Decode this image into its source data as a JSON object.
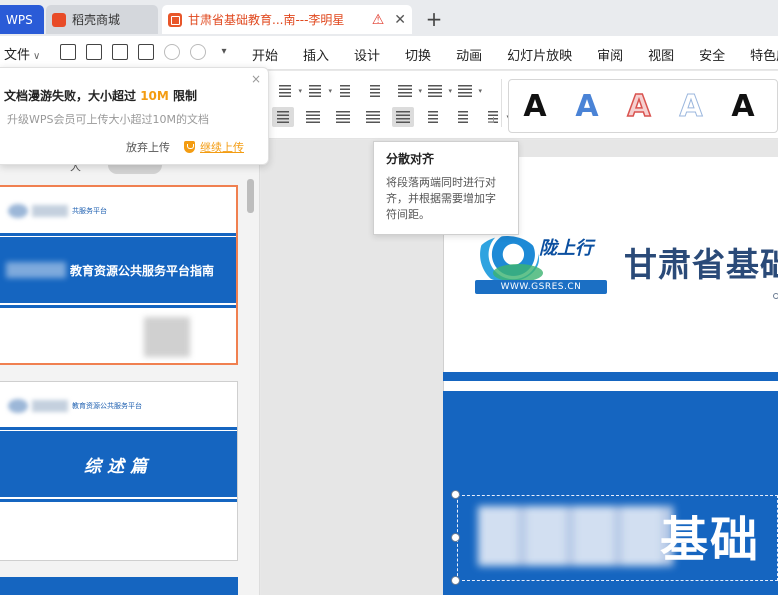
{
  "tabs": {
    "wps_label": "WPS",
    "daoke_label": "稻壳商城",
    "active_label": "甘肃省基础教育...南---李明星",
    "new_tab_label": "+"
  },
  "menu": {
    "file_label": "文件",
    "items": [
      "开始",
      "插入",
      "设计",
      "切换",
      "动画",
      "幻灯片放映",
      "审阅",
      "视图",
      "安全",
      "特色应"
    ]
  },
  "popup": {
    "title_prefix": "文档漫游失败，大小超过 ",
    "title_highlight": "10M",
    "title_suffix": " 限制",
    "subtitle": "升级WPS会员可上传大小超过10M的文档",
    "abandon_label": "放弃上传",
    "continue_label": "继续上传",
    "close_label": "×"
  },
  "tooltip": {
    "title": "分散对齐",
    "body": "将段落两端同时进行对齐，并根据需要增加字符间距。"
  },
  "ribbon": {
    "style_letters": [
      "A",
      "A",
      "A",
      "A",
      "A"
    ]
  },
  "thumbnails": {
    "tab_left": "大",
    "tab_pill": "",
    "slide1_header": "共服务平台",
    "slide1_title": "教育资源公共服务平台指南",
    "slide2_header": "教育资源公共服务平台",
    "slide2_title": "综述篇"
  },
  "slide": {
    "logo_script": "陇上行",
    "logo_url": "WWW.GSRES.CN",
    "heading": "甘肃省基础",
    "big_text": "基础"
  },
  "colors": {
    "brand_blue": "#1565c0",
    "warning_orange": "#f39c12",
    "tab_active_text": "#e0481e"
  }
}
